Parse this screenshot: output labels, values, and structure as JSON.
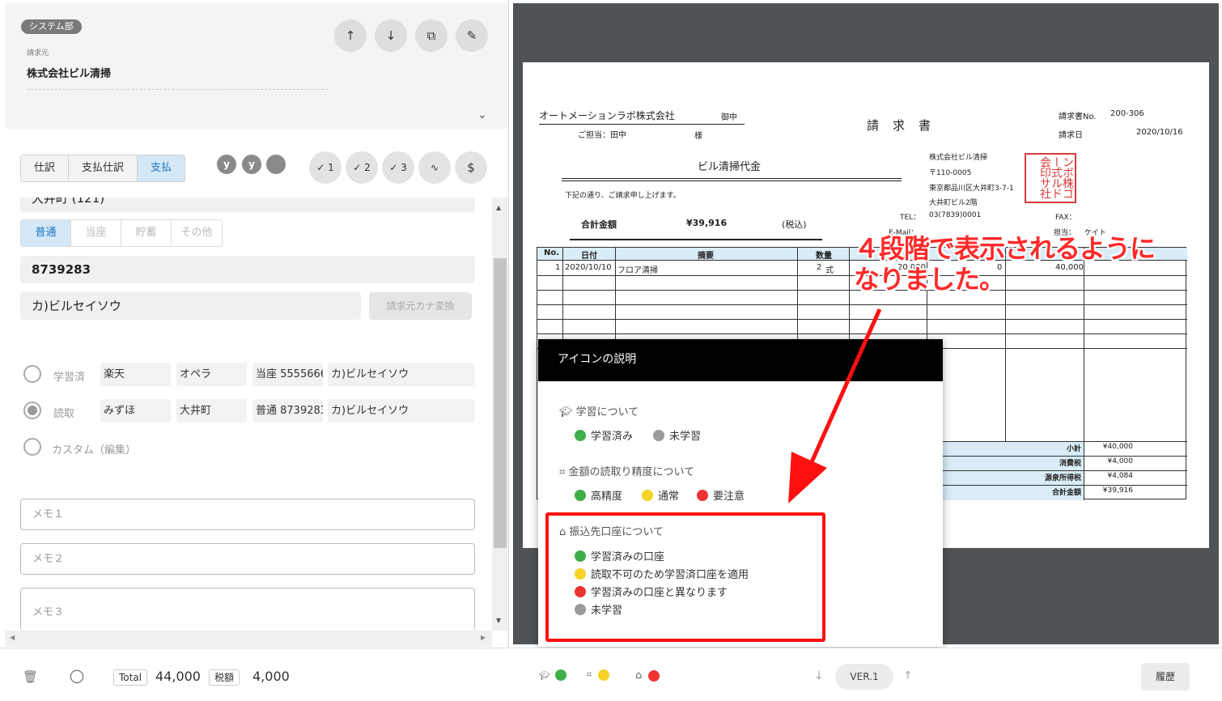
{
  "header": {
    "dept_tag": "システム部",
    "field_label": "請求元",
    "vendor_name": "株式会社ビル清掃"
  },
  "tabs": [
    "仕訳",
    "支払仕訳",
    "支払"
  ],
  "status_letters": [
    "y",
    "y",
    ""
  ],
  "check_buttons": [
    "1",
    "2",
    "3"
  ],
  "bank": {
    "branch_partial": "大井町 (121)",
    "account_types": [
      "普通",
      "当座",
      "貯蓄",
      "その他"
    ],
    "account_number": "8739283",
    "account_name_kana": "カ)ビルセイソウ",
    "convert_button": "請求元カナ変換"
  },
  "account_options": [
    {
      "label": "学習済",
      "bank": "楽天",
      "branch": "オペラ",
      "number": "当座 5555666",
      "name": "カ)ビルセイソウ"
    },
    {
      "label": "読取",
      "bank": "みずほ",
      "branch": "大井町",
      "number": "普通 8739283",
      "name": "カ)ビルセイソウ"
    },
    {
      "label": "カスタム（編集）"
    }
  ],
  "memos": [
    "メモ１",
    "メモ２",
    "メモ３"
  ],
  "footer": {
    "total_label": "Total",
    "total_value": "44,000",
    "tax_label": "税額",
    "tax_value": "4,000"
  },
  "invoice": {
    "customer": "オートメーションラボ株式会社",
    "honorific": "御中",
    "contact": "ご担当：田中",
    "sama": "様",
    "title": "請　求　書",
    "no_label": "請求書No.",
    "no_value": "200-306",
    "date_label": "請求日",
    "date_value": "2020/10/16",
    "subject": "ビル清掃代金",
    "greeting": "下記の通り、ご請求申し上げます。",
    "amount_label": "合計金額",
    "amount_value": "¥39,916",
    "tax_incl": "(税込)",
    "issuer_name": "株式会社ビル清掃",
    "issuer_zip": "〒110-0005",
    "issuer_addr1": "東京都品川区大井町3-7-1",
    "issuer_addr2": "大井町ビル2階",
    "tel_label": "TEL：",
    "tel_value": "03(7839)0001",
    "fax_label": "FAX：",
    "email_label": "E-Mail：",
    "rep_label": "担当：",
    "rep_value": "ケイト",
    "stamp_text": "ンボ株ゴー式ルド会印サ社",
    "table_headers": [
      "No.",
      "日付",
      "摘要",
      "数量"
    ],
    "row1": {
      "no": "1",
      "date": "2020/10/10",
      "desc": "フロア清掃",
      "qty": "2",
      "unit": "式",
      "price": "20,000",
      "tax": "0",
      "amount": "40,000"
    },
    "totals": [
      {
        "label": "小計",
        "value": "¥40,000"
      },
      {
        "label": "消費税",
        "value": "¥4,000"
      },
      {
        "label": "源泉所得税",
        "value": "¥4,084"
      },
      {
        "label": "合計金額",
        "value": "¥39,916"
      }
    ]
  },
  "popup": {
    "title": "アイコンの説明",
    "sec1_title": "学習について",
    "sec1_items": [
      "学習済み",
      "未学習"
    ],
    "sec2_title": "金額の読取り精度について",
    "sec2_items": [
      "高精度",
      "通常",
      "要注意"
    ],
    "sec3_title": "振込先口座について",
    "sec3_items": [
      "学習済みの口座",
      "読取不可のため学習済口座を適用",
      "学習済みの口座と異なります",
      "未学習"
    ]
  },
  "annotation": {
    "line1": "４段階で表示されるように",
    "line2": "なりました。"
  },
  "viewer_footer": {
    "version": "VER.1",
    "history_button": "履歴"
  },
  "colors": {
    "green": "#3fae49",
    "yellow": "#f5d328",
    "red": "#ee3333",
    "gray": "#9a9a9a",
    "accent_blue": "#1f76c0",
    "annotation_red": "#ff1010"
  }
}
